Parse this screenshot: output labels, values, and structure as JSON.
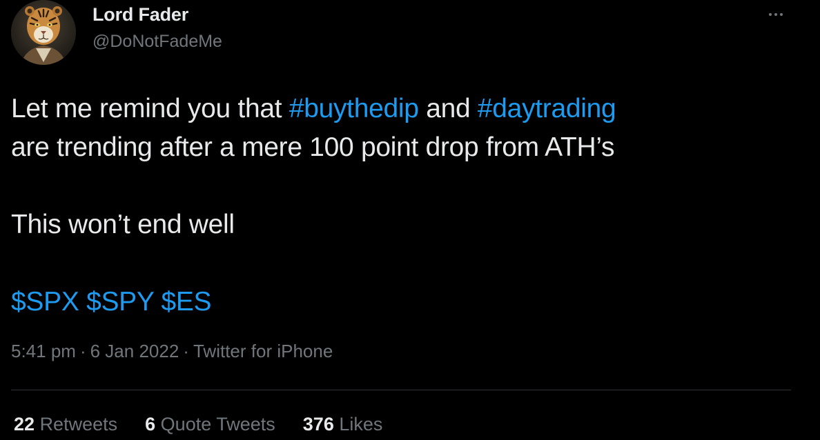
{
  "user": {
    "display_name": "Lord Fader",
    "handle": "@DoNotFadeMe",
    "avatar_icon": "tiger-avatar-icon"
  },
  "tweet": {
    "line1_prefix": "Let me remind you that ",
    "hashtag1": "#buythedip",
    "line1_mid": " and ",
    "hashtag2": "#daytrading",
    "line2": "are trending after a mere 100 point drop from ATH’s",
    "line3": "This won’t end well",
    "cashtag1": "$SPX",
    "cashtag2": "$SPY",
    "cashtag3": "$ES"
  },
  "meta": {
    "time": "5:41 pm",
    "date": "6 Jan 2022",
    "source": "Twitter for iPhone",
    "separator": "·"
  },
  "stats": {
    "retweets_count": "22",
    "retweets_label": "Retweets",
    "quote_count": "6",
    "quote_label": "Quote Tweets",
    "likes_count": "376",
    "likes_label": "Likes"
  },
  "colors": {
    "background": "#000000",
    "text": "#e7e9ea",
    "secondary": "#71767b",
    "link": "#1d9bf0",
    "divider": "#2f3336"
  }
}
